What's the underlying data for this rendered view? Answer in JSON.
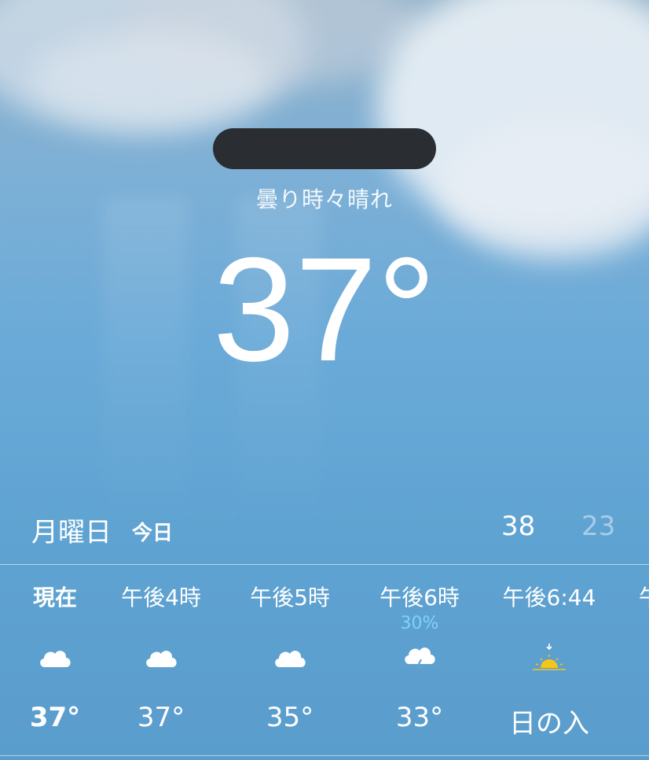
{
  "header": {
    "condition": "曇り時々晴れ",
    "temperature": "37°"
  },
  "today": {
    "day_name": "月曜日",
    "label": "今日",
    "high": "38",
    "low": "23"
  },
  "hourly": [
    {
      "time": "現在",
      "temp": "37°",
      "icon": "cloud-icon",
      "precip": ""
    },
    {
      "time": "午後4時",
      "temp": "37°",
      "icon": "cloud-icon",
      "precip": ""
    },
    {
      "time": "午後5時",
      "temp": "35°",
      "icon": "cloud-icon",
      "precip": ""
    },
    {
      "time": "午後6時",
      "temp": "33°",
      "icon": "thunderstorm-icon",
      "precip": "30%"
    },
    {
      "time": "午後6:44",
      "temp": "日の入",
      "icon": "sunset-icon",
      "precip": ""
    },
    {
      "time": "午",
      "temp": "",
      "icon": "",
      "precip": ""
    }
  ],
  "colors": {
    "precip": "#7fd1ff",
    "sun": "#f5c518",
    "redaction": "#2a2e33"
  }
}
